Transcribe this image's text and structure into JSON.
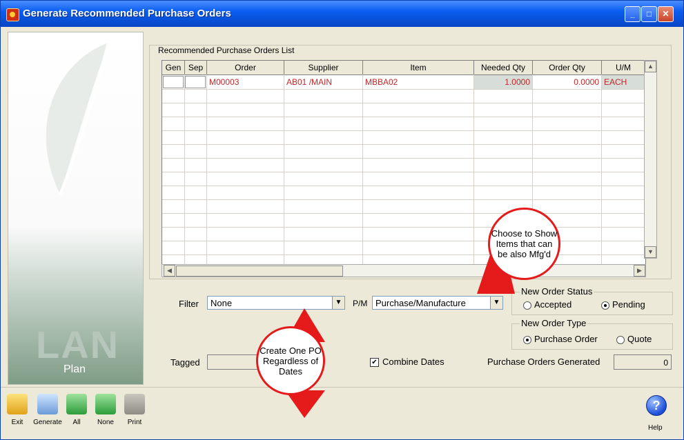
{
  "window": {
    "title": "Generate Recommended Purchase Orders"
  },
  "sidebar": {
    "brand": "LAN",
    "sub": "Plan"
  },
  "list": {
    "legend": "Recommended Purchase Orders List",
    "columns": [
      "Gen",
      "Sep",
      "Order",
      "Supplier",
      "Item",
      "Needed Qty",
      "Order Qty",
      "U/M"
    ],
    "rows": [
      {
        "gen": "",
        "sep": "",
        "order": "M00003",
        "supplier": "AB01  /MAIN",
        "item": "MBBA02",
        "needed_qty": "1.0000",
        "order_qty": "0.0000",
        "um": "EACH"
      }
    ]
  },
  "filter": {
    "label": "Filter",
    "value": "None"
  },
  "pm": {
    "label": "P/M",
    "value": "Purchase/Manufacture"
  },
  "status": {
    "legend": "New Order Status",
    "accepted": "Accepted",
    "pending": "Pending",
    "selected": "pending"
  },
  "type": {
    "legend": "New Order Type",
    "purchase_order": "Purchase Order",
    "quote": "Quote",
    "selected": "purchase_order"
  },
  "tagged": {
    "label": "Tagged",
    "value": ""
  },
  "combine": {
    "label": "Combine Dates",
    "checked": true,
    "mark": "✔"
  },
  "generated": {
    "label": "Purchase Orders Generated",
    "value": "0"
  },
  "toolbar": {
    "exit": "Exit",
    "generate": "Generate",
    "all": "All",
    "none": "None",
    "print": "Print",
    "help": "Help",
    "help_glyph": "?"
  },
  "callouts": {
    "mfg": "Choose to Show Items that can be also Mfg'd",
    "po": "Create One PO Regardless of Dates"
  },
  "colors": {
    "accent_red": "#e51a1a",
    "data_red": "#c0282a",
    "title_blue": "#0a5ef0"
  }
}
